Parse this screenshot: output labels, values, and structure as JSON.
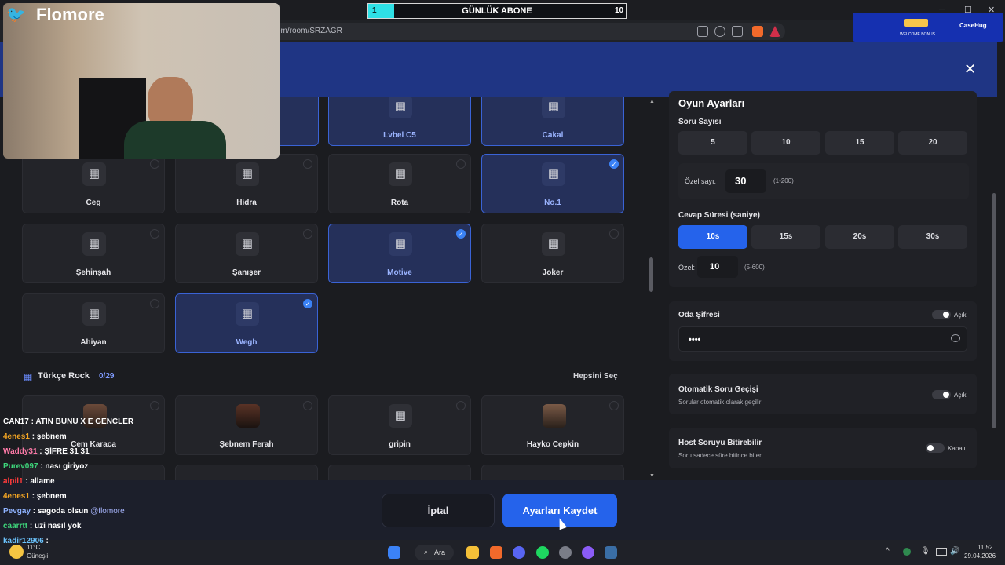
{
  "browser": {
    "url": "om/room/SRZAGR",
    "win_min": "─",
    "win_max": "☐",
    "win_close": "✕"
  },
  "banner": {
    "close": "✕"
  },
  "stream": {
    "channel": "Flomore",
    "subgoal": {
      "title": "GÜNLÜK ABONE",
      "current": "1",
      "target": "10",
      "progress": 0.1
    },
    "ad": {
      "line1": "WELCOME BONUS",
      "brand": "CaseHug"
    }
  },
  "artists_top_row": [
    "Lvbel C5",
    "Cakal"
  ],
  "artists": [
    {
      "name": "Ceg",
      "selected": false
    },
    {
      "name": "Hidra",
      "selected": false
    },
    {
      "name": "Rota",
      "selected": false
    },
    {
      "name": "No.1",
      "selected": true
    },
    {
      "name": "Şehinşah",
      "selected": false
    },
    {
      "name": "Şanışer",
      "selected": false
    },
    {
      "name": "Motive",
      "selected": true
    },
    {
      "name": "Joker",
      "selected": false
    },
    {
      "name": "Ahiyan",
      "selected": false
    },
    {
      "name": "Wegh",
      "selected": true
    }
  ],
  "section": {
    "name": "Türkçe Rock",
    "count": "0/29",
    "select_all": "Hepsini Seç"
  },
  "rock_artists": [
    "Cem Karaca",
    "Şebnem Ferah",
    "gripin",
    "Hayko Cepkin"
  ],
  "settings": {
    "title": "Oyun Ayarları",
    "question_count": {
      "label": "Soru Sayısı",
      "options": [
        "5",
        "10",
        "15",
        "20"
      ],
      "custom_label": "Özel sayı:",
      "custom_value": "30",
      "range": "(1-200)"
    },
    "answer_time": {
      "label": "Cevap Süresi (saniye)",
      "options": [
        "10s",
        "15s",
        "20s",
        "30s"
      ],
      "active": "10s",
      "custom_label": "Özel:",
      "custom_value": "10",
      "range": "(5-600)"
    },
    "password": {
      "label": "Oda Şifresi",
      "toggle": "Açık",
      "value": "••••"
    },
    "auto_next": {
      "label": "Otomatik Soru Geçişi",
      "desc": "Sorular otomatik olarak geçilir",
      "toggle": "Açık"
    },
    "host_end": {
      "label": "Host Soruyu Bitirebilir",
      "desc": "Soru sadece süre bitince biter",
      "toggle": "Kapalı"
    }
  },
  "footer": {
    "cancel": "İptal",
    "save": "Ayarları Kaydet"
  },
  "chat": [
    {
      "user": "CAN17",
      "msg": "ATIN BUNU X E GENCLER",
      "color": "#ffffff"
    },
    {
      "user": "4enes1",
      "msg": "şebnem",
      "color": "#f5a623"
    },
    {
      "user": "Waddy31",
      "msg": "ŞİFRE 31 31",
      "color": "#ff7aa8"
    },
    {
      "user": "Purev097",
      "msg": "nası giriyoz",
      "color": "#3ed67b"
    },
    {
      "user": "alpil1",
      "msg": "allame",
      "color": "#ff3b3b"
    },
    {
      "user": "4enes1",
      "msg": "şebnem",
      "color": "#f5a623"
    },
    {
      "user": "Pevgay",
      "msg": "sagoda olsun",
      "color": "#8fb3ff",
      "mention": "@flomore"
    },
    {
      "user": "caarrtt",
      "msg": "uzi nasıl yok",
      "color": "#3ed67b"
    },
    {
      "user": "kadir12906",
      "msg": "",
      "color": "#6cc5ff"
    }
  ],
  "taskbar": {
    "search": "Ara",
    "weather_temp": "11°C",
    "weather_desc": "Güneşli",
    "time": "11:52",
    "date": "29.04.2026"
  }
}
